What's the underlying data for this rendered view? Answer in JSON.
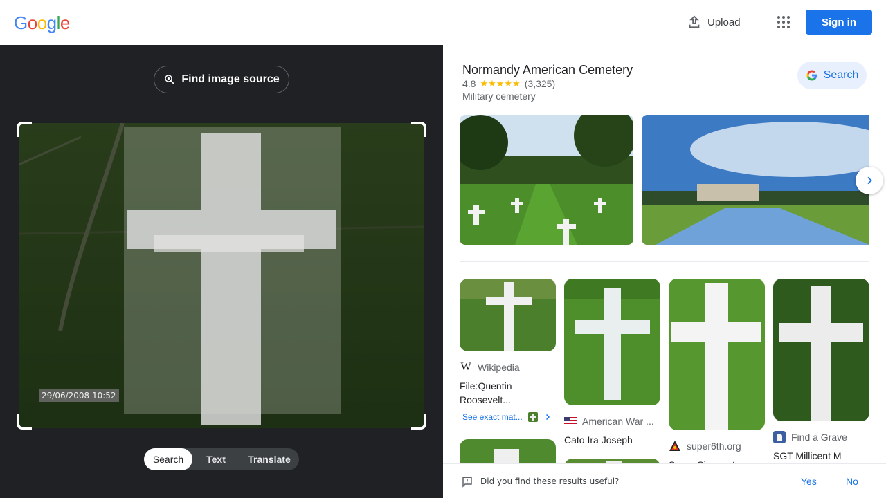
{
  "header": {
    "logo_letters": [
      {
        "ch": "G",
        "color": "#4285f4"
      },
      {
        "ch": "o",
        "color": "#ea4335"
      },
      {
        "ch": "o",
        "color": "#fbbc05"
      },
      {
        "ch": "g",
        "color": "#4285f4"
      },
      {
        "ch": "l",
        "color": "#34a853"
      },
      {
        "ch": "e",
        "color": "#ea4335"
      }
    ],
    "upload_label": "Upload",
    "signin_label": "Sign in",
    "upload_icon": "upload-icon",
    "apps_icon": "apps-grid-icon"
  },
  "left": {
    "find_source_label": "Find image source",
    "datestamp": "29/06/2008 10:52",
    "modes": [
      "Search",
      "Text",
      "Translate"
    ],
    "active_mode": "Search"
  },
  "place": {
    "title": "Normandy American Cemetery",
    "rating": "4.8",
    "stars": "★★★★★",
    "review_count": "(3,325)",
    "type": "Military cemetery",
    "search_label": "Search"
  },
  "results": [
    {
      "source": "Wikipedia",
      "title": "File:Quentin Roosevelt...",
      "exact_match_label": "See exact mat..."
    },
    {
      "source": "American War ...",
      "title": "Cato Ira Joseph"
    },
    {
      "source": "super6th.org",
      "title": "Super Sixers at"
    },
    {
      "source": "Find a Grave",
      "title": "SGT Millicent M"
    }
  ],
  "feedback": {
    "question": "Did you find these results useful?",
    "yes": "Yes",
    "no": "No"
  },
  "colors": {
    "accent": "#1a73e8",
    "dark_bg": "#202124",
    "star": "#fbbc04"
  }
}
